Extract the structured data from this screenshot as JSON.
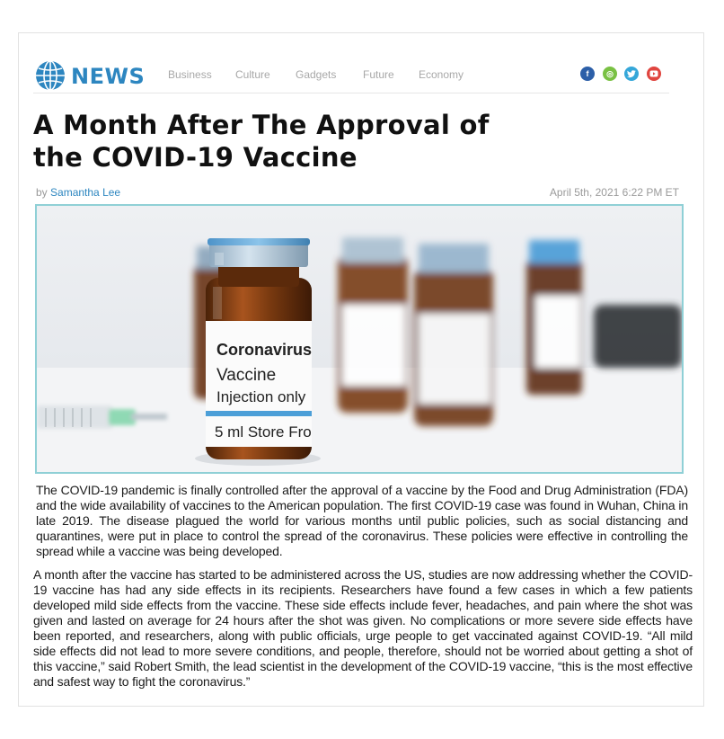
{
  "site": {
    "brand": "NEWS",
    "nav": [
      "Business",
      "Culture",
      "Gadgets",
      "Future",
      "Economy"
    ],
    "social": [
      {
        "icon": "facebook-icon",
        "glyph": "f",
        "color": "#2c5fa8"
      },
      {
        "icon": "instagram-icon",
        "glyph": "◎",
        "color": "#79c143"
      },
      {
        "icon": "twitter-icon",
        "glyph": "🐦",
        "color": "#35a7d9"
      },
      {
        "icon": "youtube-icon",
        "glyph": "▶",
        "color": "#e0453f"
      }
    ]
  },
  "article": {
    "title_line1": "A Month After The Approval of",
    "title_line2": "the COVID-19 Vaccine",
    "by_prefix": "by",
    "author": "Samantha Lee",
    "date": "April 5th, 2021 6:22 PM ET",
    "image": {
      "label_line1": "Coronavirus",
      "label_line2": "Vaccine",
      "label_line3": "Injection only",
      "label_line4": "5 ml  Store Fro"
    },
    "paragraph1": "The COVID-19 pandemic is finally controlled after the approval of a vaccine by the Food and Drug Administration (FDA) and the wide availability of vaccines to the American population. The first COVID-19 case was found in Wuhan, China in late 2019. The disease plagued the world for various months until public policies, such as social distancing and quarantines, were put in place to control the spread of the coronavirus. These policies were effective in controlling the spread while a vaccine was being developed.",
    "paragraph2": "A month after the vaccine has started to be administered across the US, studies are now addressing whether the COVID-19 vaccine has had any side effects in its recipients. Researchers have found a few cases in which a few patients developed mild side effects from the vaccine. These side effects include fever, headaches, and pain where the shot was given and lasted on average for 24 hours after the shot was given. No complications or more severe side effects have been reported, and researchers, along with public officials, urge people to get vaccinated against COVID-19. “All mild side effects did not lead to more severe conditions, and people, therefore, should not be worried about getting a shot of this vaccine,” said Robert Smith, the lead scientist in the development of the COVID-19 vaccine, “this is the most effective and safest way to fight the coronavirus.”"
  }
}
